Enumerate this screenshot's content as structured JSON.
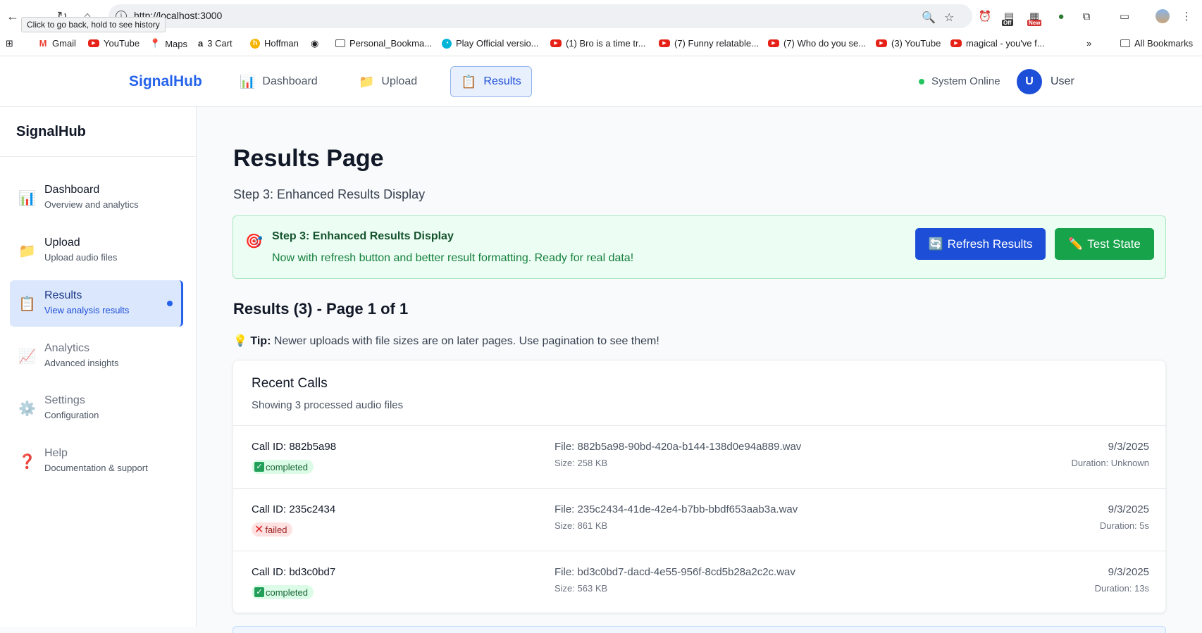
{
  "browser": {
    "url": "http://localhost:3000",
    "tooltip": "Click to go back, hold to see history",
    "ext_off_label": "Off",
    "ext_new_label": "New",
    "bookmarks": [
      {
        "label": "Gmail",
        "icon": "gmail-icon"
      },
      {
        "label": "YouTube",
        "icon": "youtube-icon"
      },
      {
        "label": "Maps",
        "icon": "maps-icon"
      },
      {
        "label": "3 Cart",
        "icon": "amazon-icon"
      },
      {
        "label": "Hoffman",
        "icon": "hoffman-icon"
      },
      {
        "label": "",
        "icon": "globe-icon"
      },
      {
        "label": "Personal_Bookma...",
        "icon": "folder-icon"
      },
      {
        "label": "Play Official versio...",
        "icon": "play-icon"
      },
      {
        "label": "(1) Bro is a time tr...",
        "icon": "youtube-icon"
      },
      {
        "label": "(7) Funny relatable...",
        "icon": "youtube-icon"
      },
      {
        "label": "(7) Who do you se...",
        "icon": "youtube-icon"
      },
      {
        "label": "(3) YouTube",
        "icon": "youtube-icon"
      },
      {
        "label": "magical - you've f...",
        "icon": "youtube-icon"
      }
    ],
    "more_bookmarks": "»",
    "all_bookmarks": "All Bookmarks"
  },
  "header": {
    "brand": "SignalHub",
    "nav": [
      {
        "label": "Dashboard",
        "icon": "bar-chart-icon"
      },
      {
        "label": "Upload",
        "icon": "folder-icon"
      },
      {
        "label": "Results",
        "icon": "clipboard-icon"
      }
    ],
    "status": "System Online",
    "avatar_initial": "U",
    "user": "User"
  },
  "sidebar": {
    "brand": "SignalHub",
    "items": [
      {
        "title": "Dashboard",
        "sub": "Overview and analytics",
        "icon": "bar-chart-icon"
      },
      {
        "title": "Upload",
        "sub": "Upload audio files",
        "icon": "folder-icon"
      },
      {
        "title": "Results",
        "sub": "View analysis results",
        "icon": "clipboard-icon"
      },
      {
        "title": "Analytics",
        "sub": "Advanced insights",
        "icon": "line-chart-icon"
      },
      {
        "title": "Settings",
        "sub": "Configuration",
        "icon": "gear-icon"
      },
      {
        "title": "Help",
        "sub": "Documentation & support",
        "icon": "question-icon"
      }
    ]
  },
  "main": {
    "title": "Results Page",
    "subtitle": "Step 3: Enhanced Results Display",
    "banner": {
      "title": "Step 3: Enhanced Results Display",
      "text": "Now with refresh button and better result formatting. Ready for real data!",
      "refresh_label": "Refresh Results",
      "test_label": "Test State"
    },
    "results_heading": "Results (3) - Page 1 of 1",
    "tip_label": "Tip:",
    "tip_text": " Newer uploads with file sizes are on later pages. Use pagination to see them!",
    "card": {
      "title": "Recent Calls",
      "subtitle": "Showing 3 processed audio files",
      "rows": [
        {
          "call_id": "Call ID: 882b5a98",
          "status": "completed",
          "file": "File: 882b5a98-90bd-420a-b144-138d0e94a889.wav",
          "size": "Size: 258 KB",
          "date": "9/3/2025",
          "duration": "Duration: Unknown"
        },
        {
          "call_id": "Call ID: 235c2434",
          "status": "failed",
          "file": "File: 235c2434-41de-42e4-b7bb-bbdf653aab3a.wav",
          "size": "Size: 861 KB",
          "date": "9/3/2025",
          "duration": "Duration: 5s"
        },
        {
          "call_id": "Call ID: bd3c0bd7",
          "status": "completed",
          "file": "File: bd3c0bd7-dacd-4e55-956f-8cd5b28a2c2c.wav",
          "size": "Size: 563 KB",
          "date": "9/3/2025",
          "duration": "Duration: 13s"
        }
      ]
    }
  },
  "colors": {
    "brand": "#2563eb",
    "success": "#16a34a",
    "danger": "#dc2626",
    "online": "#22c55e"
  }
}
